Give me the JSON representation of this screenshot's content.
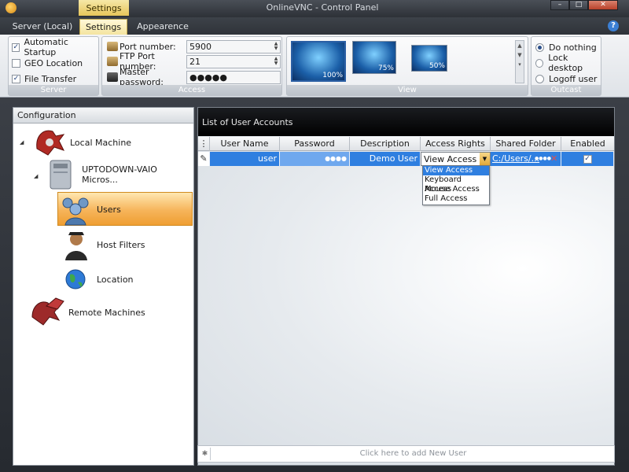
{
  "window": {
    "title": "OnlineVNC - Control Panel",
    "context_tab": "Settings"
  },
  "tabs": {
    "server": "Server (Local)",
    "settings": "Settings",
    "appearance": "Appearence"
  },
  "ribbon": {
    "server": {
      "label": "Server",
      "items": [
        {
          "label": "Automatic Startup",
          "checked": true
        },
        {
          "label": "GEO Location",
          "checked": false
        },
        {
          "label": "File Transfer",
          "checked": true
        }
      ]
    },
    "access": {
      "label": "Access",
      "port_label": "Port number:",
      "port_value": "5900",
      "ftp_label": "FTP Port number:",
      "ftp_value": "21",
      "password_label": "Master password:",
      "password_value": "●●●●●"
    },
    "view": {
      "label": "View",
      "zoom": [
        "100%",
        "75%",
        "50%"
      ]
    },
    "outcast": {
      "label": "Outcast",
      "options": [
        "Do nothing",
        "Lock desktop",
        "Logoff user"
      ],
      "selected": 0
    }
  },
  "config": {
    "title": "Configuration",
    "local_machine": "Local Machine",
    "computer": "UPTODOWN-VAIO Micros...",
    "users": "Users",
    "host_filters": "Host Filters",
    "location": "Location",
    "remote_machines": "Remote Machines"
  },
  "accounts": {
    "title": "List of User Accounts",
    "columns": [
      "User Name",
      "Password",
      "Description",
      "Access Rights",
      "Shared Folder",
      "Enabled"
    ],
    "row": {
      "user_name": "user",
      "password": "●●●●",
      "description": "Demo User",
      "access_rights": "View Access",
      "shared_folder": "C:/Users/...",
      "folder_dots": "●●●●",
      "enabled": true
    },
    "access_options": [
      "View Access",
      "Keyboard Access",
      "Mouse Access",
      "Full Access"
    ],
    "add_placeholder": "Click here to add New User"
  },
  "colors": {
    "selection": "#2f7fe0",
    "ribbon_tab": "#f4e4a0",
    "users_highlight": "#f6b45a"
  }
}
